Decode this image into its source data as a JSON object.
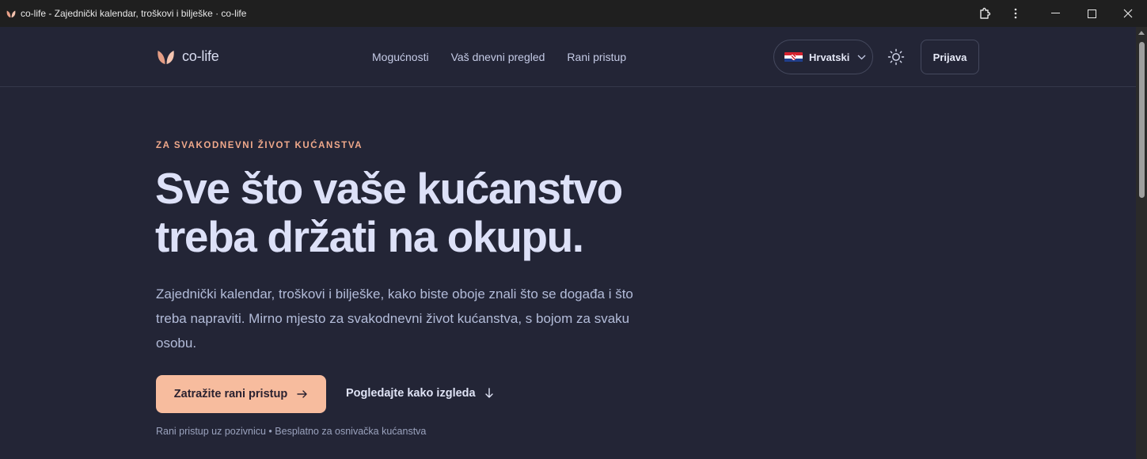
{
  "window": {
    "title": "co-life - Zajednički kalendar, troškovi i bilješke · co-life"
  },
  "nav": {
    "logo_text": "co-life",
    "links": [
      {
        "label": "Mogućnosti"
      },
      {
        "label": "Vaš dnevni pregled"
      },
      {
        "label": "Rani pristup"
      }
    ],
    "language": {
      "selected": "Hrvatski"
    },
    "login_label": "Prijava"
  },
  "hero": {
    "eyebrow": "ZA SVAKODNEVNI ŽIVOT KUĆANSTVA",
    "title_line1": "Sve što vaše kućanstvo",
    "title_line2": "treba držati na okupu.",
    "subtitle": "Zajednički kalendar, troškovi i bilješke, kako biste oboje znali što se događa i što treba napraviti. Mirno mjesto za svakodnevni život kućanstva, s bojom za svaku osobu.",
    "cta_label": "Zatražite rani pristup",
    "secondary_label": "Pogledajte kako izgleda",
    "footnote": "Rani pristup uz pozivnicu • Besplatno za osnivačka kućanstva"
  },
  "colors": {
    "background": "#232536",
    "accent": "#f7bc9e",
    "eyebrow": "#f0a98b",
    "heading": "#dde1f8"
  },
  "icons": {
    "favicon": "co-life-leaf-icon",
    "extensions": "puzzle-icon",
    "menu": "vertical-dots-icon",
    "theme": "sun-icon",
    "cta_arrow": "arrow-right-icon",
    "secondary_arrow": "arrow-down-icon"
  }
}
